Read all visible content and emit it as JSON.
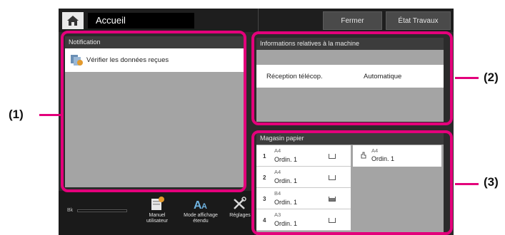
{
  "header": {
    "home_label": "home",
    "title": "Accueil",
    "close_label": "Fermer",
    "job_status_label": "État Travaux"
  },
  "notification": {
    "title": "Notification",
    "items": [
      {
        "icon": "received-data-icon",
        "label": "Vérifier les données reçues"
      }
    ]
  },
  "machine_info": {
    "title": "Informations relatives à la machine",
    "rows": [
      {
        "key": "Réception télécop.",
        "value": "Automatique"
      }
    ]
  },
  "paper_tray": {
    "title": "Magasin papier",
    "trays": [
      {
        "number": "1",
        "size": "A4",
        "type": "Ordin. 1",
        "level": "low"
      },
      {
        "number": "2",
        "size": "A4",
        "type": "Ordin. 1",
        "level": "low"
      },
      {
        "number": "3",
        "size": "B4",
        "type": "Ordin. 1",
        "level": "full"
      },
      {
        "number": "4",
        "size": "A3",
        "type": "Ordin. 1",
        "level": "low"
      }
    ],
    "bypass": {
      "size": "A4",
      "type": "Ordin. 1"
    }
  },
  "bottom": {
    "toner_label": "Bk",
    "manual_label": "Manuel utilisateur",
    "mode_label": "Mode affichage étendu",
    "settings_label": "Réglages"
  },
  "callouts": [
    "(1)",
    "(2)",
    "(3)"
  ],
  "colors": {
    "accent": "#e3007b",
    "panel": "#a4a4a4",
    "header": "#3c3c3c"
  }
}
